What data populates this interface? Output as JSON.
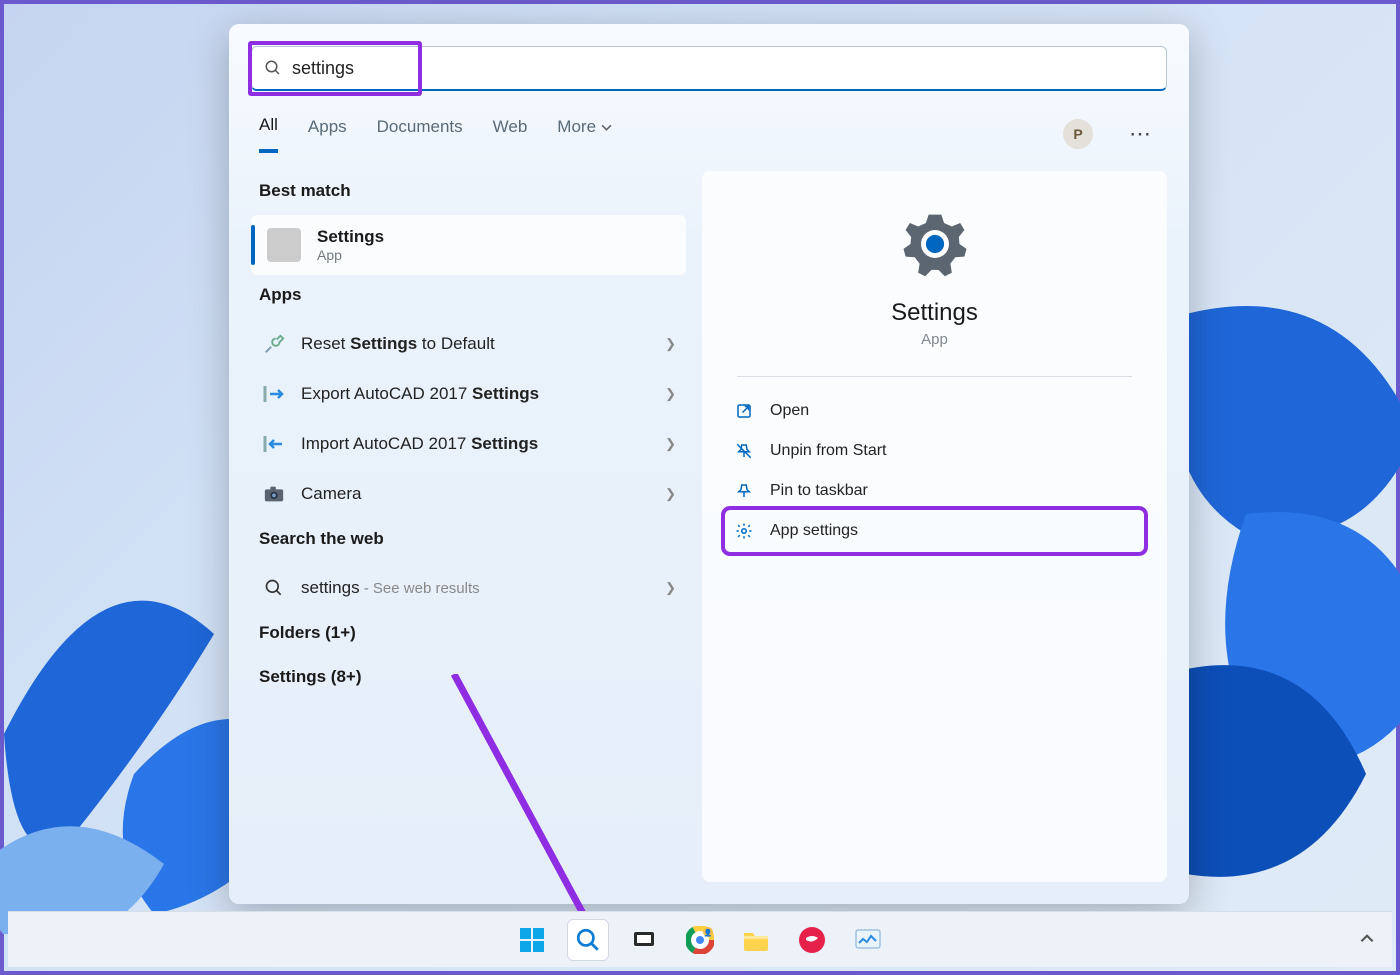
{
  "search": {
    "query": "settings"
  },
  "tabs": {
    "items": [
      "All",
      "Apps",
      "Documents",
      "Web",
      "More"
    ],
    "active": 0
  },
  "user": {
    "initial": "P"
  },
  "sections": {
    "best_match": "Best match",
    "apps": "Apps",
    "search_web": "Search the web",
    "folders": "Folders (1+)",
    "settings": "Settings (8+)"
  },
  "best_match_item": {
    "title": "Settings",
    "sub": "App"
  },
  "apps_list": [
    {
      "prefix": "Reset ",
      "bold": "Settings",
      "suffix": " to Default",
      "icon": "wrench-icon"
    },
    {
      "prefix": "Export AutoCAD 2017 ",
      "bold": "Settings",
      "suffix": "",
      "icon": "export-icon"
    },
    {
      "prefix": "Import AutoCAD 2017 ",
      "bold": "Settings",
      "suffix": "",
      "icon": "import-icon"
    },
    {
      "prefix": "Camera",
      "bold": "",
      "suffix": "",
      "icon": "camera-icon"
    }
  ],
  "web_result": {
    "term": "settings",
    "hint": " - See web results"
  },
  "detail": {
    "title": "Settings",
    "sub": "App",
    "actions": [
      {
        "label": "Open",
        "icon": "open-icon"
      },
      {
        "label": "Unpin from Start",
        "icon": "unpin-icon"
      },
      {
        "label": "Pin to taskbar",
        "icon": "pin-icon"
      },
      {
        "label": "App settings",
        "icon": "gear-icon",
        "highlighted": true
      }
    ]
  },
  "taskbar": {
    "icons": [
      "start-icon",
      "search-icon",
      "taskview-icon",
      "chrome-icon",
      "explorer-icon",
      "app-red-icon",
      "monitor-icon"
    ]
  }
}
